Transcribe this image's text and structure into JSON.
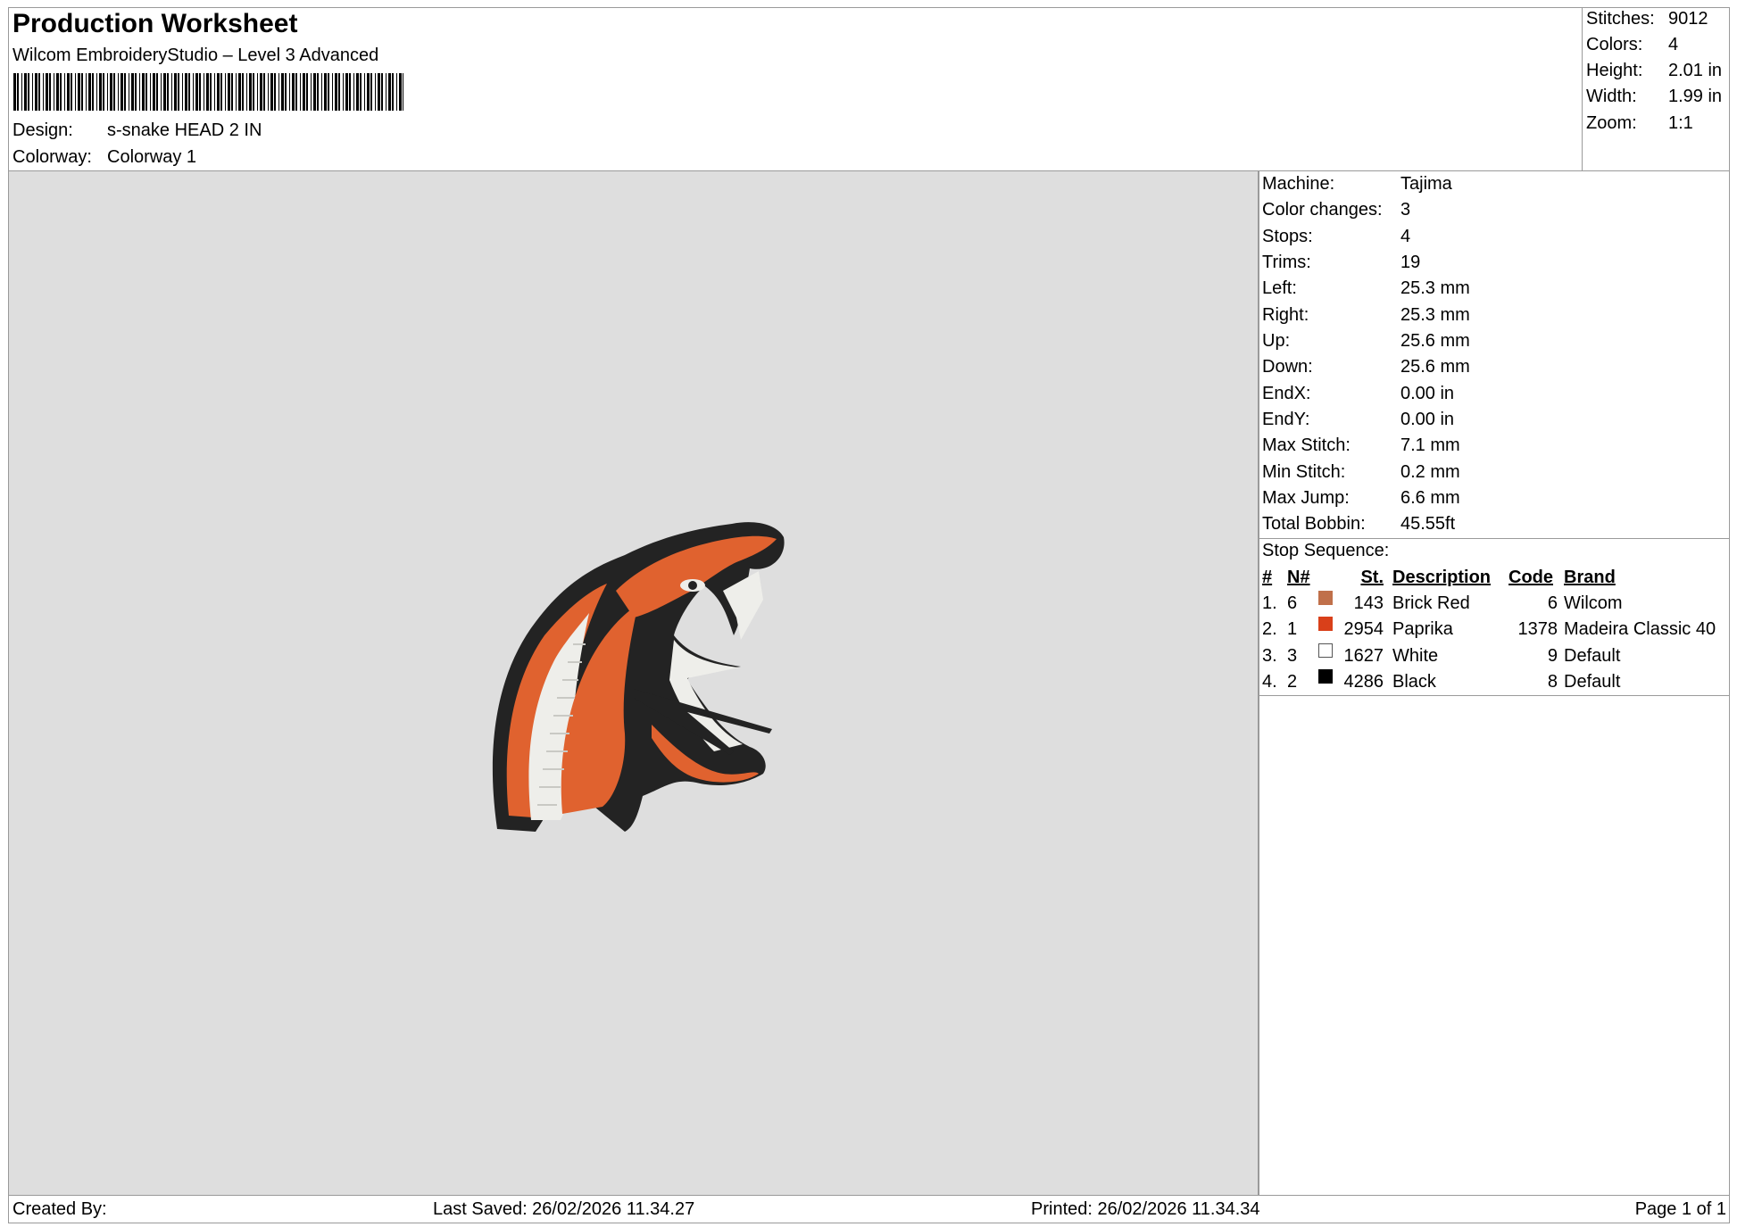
{
  "header": {
    "title": "Production Worksheet",
    "software": "Wilcom EmbroideryStudio – Level 3 Advanced",
    "design_label": "Design:",
    "design_value": "s-snake HEAD 2 IN",
    "colorway_label": "Colorway:",
    "colorway_value": "Colorway 1"
  },
  "summary": [
    {
      "label": "Stitches:",
      "value": "9012"
    },
    {
      "label": "Colors:",
      "value": "4"
    },
    {
      "label": "Height:",
      "value": "2.01 in"
    },
    {
      "label": "Width:",
      "value": "1.99 in"
    },
    {
      "label": "Zoom:",
      "value": "1:1"
    }
  ],
  "machine_info": [
    {
      "label": "Machine:",
      "value": "Tajima"
    },
    {
      "label": "Color changes:",
      "value": "3"
    },
    {
      "label": "Stops:",
      "value": "4"
    },
    {
      "label": "Trims:",
      "value": "19"
    },
    {
      "label": "Left:",
      "value": "25.3 mm"
    },
    {
      "label": "Right:",
      "value": "25.3 mm"
    },
    {
      "label": "Up:",
      "value": "25.6 mm"
    },
    {
      "label": "Down:",
      "value": "25.6 mm"
    },
    {
      "label": "EndX:",
      "value": "0.00 in"
    },
    {
      "label": "EndY:",
      "value": "0.00 in"
    },
    {
      "label": "Max Stitch:",
      "value": "7.1 mm"
    },
    {
      "label": "Min Stitch:",
      "value": "0.2 mm"
    },
    {
      "label": "Max Jump:",
      "value": "6.6 mm"
    },
    {
      "label": "Total Bobbin:",
      "value": "45.55ft"
    }
  ],
  "stop_sequence": {
    "title": "Stop Sequence:",
    "columns": {
      "num": "#",
      "n": "N#",
      "st": "St.",
      "description": "Description",
      "code": "Code",
      "brand": "Brand"
    },
    "rows": [
      {
        "num": "1.",
        "n": "6",
        "st": "143",
        "description": "Brick Red",
        "code": "6",
        "brand": "Wilcom",
        "color": "#c0704a"
      },
      {
        "num": "2.",
        "n": "1",
        "st": "2954",
        "description": "Paprika",
        "code": "1378",
        "brand": "Madeira Classic 40",
        "color": "#d9401a"
      },
      {
        "num": "3.",
        "n": "3",
        "st": "1627",
        "description": "White",
        "code": "9",
        "brand": "Default",
        "color": "#ffffff"
      },
      {
        "num": "4.",
        "n": "2",
        "st": "4286",
        "description": "Black",
        "code": "8",
        "brand": "Default",
        "color": "#000000"
      }
    ]
  },
  "footer": {
    "created_by": "Created By:",
    "last_saved": "Last Saved: 26/02/2026 11.34.27",
    "printed": "Printed: 26/02/2026 11.34.34",
    "page": "Page 1 of 1"
  }
}
